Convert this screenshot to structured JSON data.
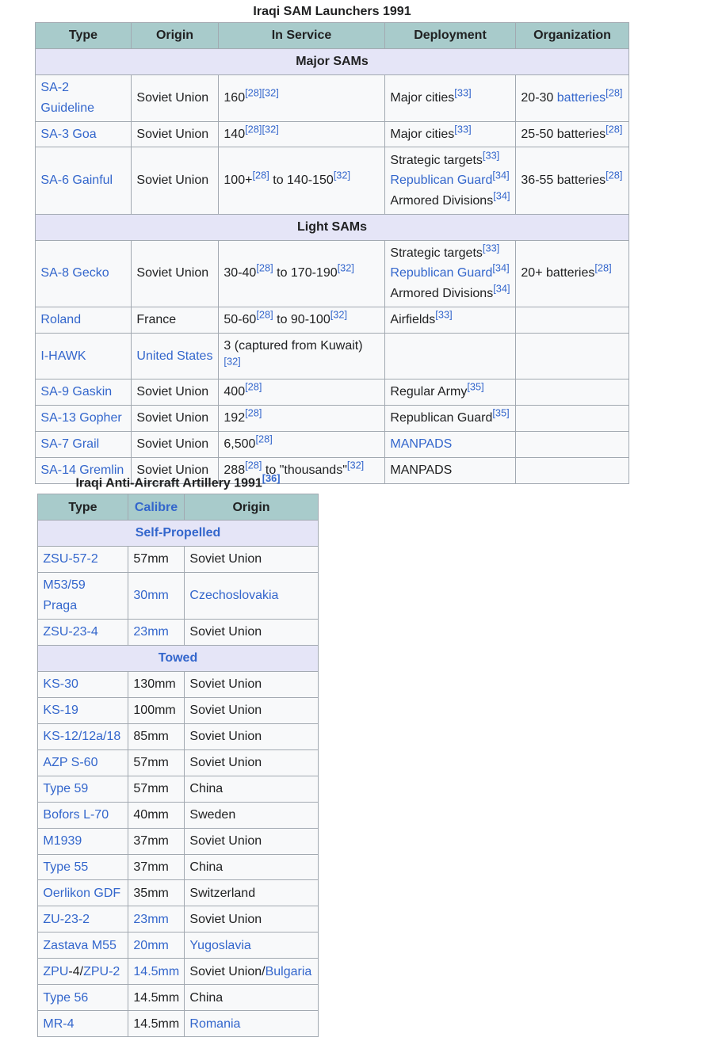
{
  "sam": {
    "caption": "Iraqi SAM Launchers 1991",
    "headers": [
      [
        {
          "t": "Type"
        }
      ],
      [
        {
          "t": "Origin"
        }
      ],
      [
        {
          "t": "In Service"
        }
      ],
      [
        {
          "t": "Deployment"
        }
      ],
      [
        {
          "t": "Organization"
        }
      ]
    ],
    "sections": [
      {
        "title": [
          {
            "t": "Major SAMs"
          }
        ],
        "rows": [
          [
            [
              {
                "l": "SA-2 Guideline"
              }
            ],
            [
              {
                "t": "Soviet Union"
              }
            ],
            [
              {
                "t": "160"
              },
              {
                "r": "28"
              },
              {
                "r": "32"
              }
            ],
            [
              {
                "t": "Major cities"
              },
              {
                "r": "33"
              }
            ],
            [
              {
                "t": "20-30 "
              },
              {
                "l": "batteries"
              },
              {
                "r": "28"
              }
            ]
          ],
          [
            [
              {
                "l": "SA-3 Goa"
              }
            ],
            [
              {
                "t": "Soviet Union"
              }
            ],
            [
              {
                "t": "140"
              },
              {
                "r": "28"
              },
              {
                "r": "32"
              }
            ],
            [
              {
                "t": "Major cities"
              },
              {
                "r": "33"
              }
            ],
            [
              {
                "t": "25-50 batteries"
              },
              {
                "r": "28"
              }
            ]
          ],
          [
            [
              {
                "l": "SA-6 Gainful"
              }
            ],
            [
              {
                "t": "Soviet Union"
              }
            ],
            [
              {
                "t": "100+"
              },
              {
                "r": "28"
              },
              {
                "t": " to 140-150"
              },
              {
                "r": "32"
              }
            ],
            [
              {
                "t": "Strategic targets"
              },
              {
                "r": "33"
              },
              {
                "br": 1
              },
              {
                "l": "Republican Guard"
              },
              {
                "r": "34"
              },
              {
                "br": 1
              },
              {
                "t": "Armored Divisions"
              },
              {
                "r": "34"
              }
            ],
            [
              {
                "t": "36-55 batteries"
              },
              {
                "r": "28"
              }
            ]
          ]
        ]
      },
      {
        "title": [
          {
            "t": "Light SAMs"
          }
        ],
        "rows": [
          [
            [
              {
                "l": "SA-8 Gecko"
              }
            ],
            [
              {
                "t": "Soviet Union"
              }
            ],
            [
              {
                "t": "30-40"
              },
              {
                "r": "28"
              },
              {
                "t": " to 170-190"
              },
              {
                "r": "32"
              }
            ],
            [
              {
                "t": "Strategic targets"
              },
              {
                "r": "33"
              },
              {
                "br": 1
              },
              {
                "l": "Republican Guard"
              },
              {
                "r": "34"
              },
              {
                "br": 1
              },
              {
                "t": "Armored Divisions"
              },
              {
                "r": "34"
              }
            ],
            [
              {
                "t": "20+ batteries"
              },
              {
                "r": "28"
              }
            ]
          ],
          [
            [
              {
                "l": "Roland"
              }
            ],
            [
              {
                "t": "France"
              }
            ],
            [
              {
                "t": "50-60"
              },
              {
                "r": "28"
              },
              {
                "t": " to 90-100"
              },
              {
                "r": "32"
              }
            ],
            [
              {
                "t": "Airfields"
              },
              {
                "r": "33"
              }
            ],
            []
          ],
          [
            [
              {
                "l": "I-HAWK"
              }
            ],
            [
              {
                "l": "United States"
              }
            ],
            [
              {
                "t": "3 (captured from Kuwait)"
              },
              {
                "r": "32"
              }
            ],
            [],
            []
          ],
          [
            [
              {
                "l": "SA-9 Gaskin"
              }
            ],
            [
              {
                "t": "Soviet Union"
              }
            ],
            [
              {
                "t": "400"
              },
              {
                "r": "28"
              }
            ],
            [
              {
                "t": "Regular Army"
              },
              {
                "r": "35"
              }
            ],
            []
          ],
          [
            [
              {
                "l": "SA-13 Gopher"
              }
            ],
            [
              {
                "t": "Soviet Union"
              }
            ],
            [
              {
                "t": "192"
              },
              {
                "r": "28"
              }
            ],
            [
              {
                "t": "Republican Guard"
              },
              {
                "r": "35"
              }
            ],
            []
          ],
          [
            [
              {
                "l": "SA-7 Grail"
              }
            ],
            [
              {
                "t": "Soviet Union"
              }
            ],
            [
              {
                "t": "6,500"
              },
              {
                "r": "28"
              }
            ],
            [
              {
                "l": "MANPADS"
              }
            ],
            []
          ],
          [
            [
              {
                "l": "SA-14 Gremlin"
              }
            ],
            [
              {
                "t": "Soviet Union"
              }
            ],
            [
              {
                "t": "288"
              },
              {
                "r": "28"
              },
              {
                "t": " to \"thousands\""
              },
              {
                "r": "32"
              }
            ],
            [
              {
                "t": "MANPADS"
              }
            ],
            []
          ]
        ]
      }
    ]
  },
  "aaa": {
    "caption": "Iraqi Anti-Aircraft Artillery 1991",
    "caption_ref": "36",
    "headers": [
      [
        {
          "t": "Type"
        }
      ],
      [
        {
          "l": "Calibre"
        }
      ],
      [
        {
          "t": "Origin"
        }
      ]
    ],
    "sections": [
      {
        "title": [
          {
            "l": "Self-Propelled"
          }
        ],
        "rows": [
          [
            [
              {
                "l": "ZSU-57-2"
              }
            ],
            [
              {
                "t": "57mm"
              }
            ],
            [
              {
                "t": "Soviet Union"
              }
            ]
          ],
          [
            [
              {
                "l": "M53/59 Praga"
              }
            ],
            [
              {
                "l": "30mm"
              }
            ],
            [
              {
                "l": "Czechoslovakia"
              }
            ]
          ],
          [
            [
              {
                "l": "ZSU-23-4"
              }
            ],
            [
              {
                "l": "23mm"
              }
            ],
            [
              {
                "t": "Soviet Union"
              }
            ]
          ]
        ]
      },
      {
        "title": [
          {
            "l": "Towed"
          }
        ],
        "rows": [
          [
            [
              {
                "l": "KS-30"
              }
            ],
            [
              {
                "t": "130mm"
              }
            ],
            [
              {
                "t": "Soviet Union"
              }
            ]
          ],
          [
            [
              {
                "l": "KS-19"
              }
            ],
            [
              {
                "t": "100mm"
              }
            ],
            [
              {
                "t": "Soviet Union"
              }
            ]
          ],
          [
            [
              {
                "l": "KS-12/12a/18"
              }
            ],
            [
              {
                "t": "85mm"
              }
            ],
            [
              {
                "t": "Soviet Union"
              }
            ]
          ],
          [
            [
              {
                "l": "AZP S-60"
              }
            ],
            [
              {
                "t": "57mm"
              }
            ],
            [
              {
                "t": "Soviet Union"
              }
            ]
          ],
          [
            [
              {
                "l": "Type 59"
              }
            ],
            [
              {
                "t": "57mm"
              }
            ],
            [
              {
                "t": "China"
              }
            ]
          ],
          [
            [
              {
                "l": "Bofors L-70"
              }
            ],
            [
              {
                "t": "40mm"
              }
            ],
            [
              {
                "t": "Sweden"
              }
            ]
          ],
          [
            [
              {
                "l": "M1939"
              }
            ],
            [
              {
                "t": "37mm"
              }
            ],
            [
              {
                "t": "Soviet Union"
              }
            ]
          ],
          [
            [
              {
                "l": "Type 55"
              }
            ],
            [
              {
                "t": "37mm"
              }
            ],
            [
              {
                "t": "China"
              }
            ]
          ],
          [
            [
              {
                "l": "Oerlikon GDF"
              }
            ],
            [
              {
                "t": "35mm"
              }
            ],
            [
              {
                "t": "Switzerland"
              }
            ]
          ],
          [
            [
              {
                "l": "ZU-23-2"
              }
            ],
            [
              {
                "l": "23mm"
              }
            ],
            [
              {
                "t": "Soviet Union"
              }
            ]
          ],
          [
            [
              {
                "l": "Zastava M55"
              }
            ],
            [
              {
                "l": "20mm"
              }
            ],
            [
              {
                "l": "Yugoslavia"
              }
            ]
          ],
          [
            [
              {
                "l": "ZPU"
              },
              {
                "t": "-4/"
              },
              {
                "l": "ZPU-2"
              }
            ],
            [
              {
                "l": "14.5mm"
              }
            ],
            [
              {
                "t": "Soviet Union/"
              },
              {
                "l": "Bulgaria"
              }
            ]
          ],
          [
            [
              {
                "l": "Type 56"
              }
            ],
            [
              {
                "t": "14.5mm"
              }
            ],
            [
              {
                "t": "China"
              }
            ]
          ],
          [
            [
              {
                "l": "MR-4"
              }
            ],
            [
              {
                "t": "14.5mm"
              }
            ],
            [
              {
                "l": "Romania"
              }
            ]
          ]
        ]
      }
    ]
  }
}
